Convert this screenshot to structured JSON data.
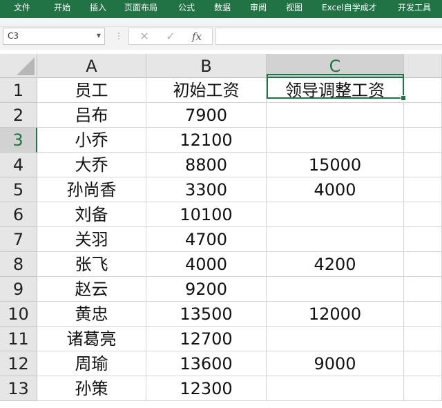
{
  "ribbon": {
    "tabs": [
      "文件",
      "开始",
      "插入",
      "页面布局",
      "公式",
      "数据",
      "审阅",
      "视图",
      "Excel自学成才",
      "开发工具"
    ]
  },
  "formula_bar": {
    "name_box": "C3",
    "cancel_icon": "✕",
    "enter_icon": "✓",
    "function_label": "fx",
    "formula": ""
  },
  "sheet": {
    "selected_cell": "C3",
    "columns": [
      "A",
      "B",
      "C"
    ],
    "rows": [
      {
        "num": "1",
        "cells": [
          "员工",
          "初始工资",
          "领导调整工资"
        ]
      },
      {
        "num": "2",
        "cells": [
          "吕布",
          "7900",
          ""
        ]
      },
      {
        "num": "3",
        "cells": [
          "小乔",
          "12100",
          ""
        ]
      },
      {
        "num": "4",
        "cells": [
          "大乔",
          "8800",
          "15000"
        ]
      },
      {
        "num": "5",
        "cells": [
          "孙尚香",
          "3300",
          "4000"
        ]
      },
      {
        "num": "6",
        "cells": [
          "刘备",
          "10100",
          ""
        ]
      },
      {
        "num": "7",
        "cells": [
          "关羽",
          "4700",
          ""
        ]
      },
      {
        "num": "8",
        "cells": [
          "张飞",
          "4000",
          "4200"
        ]
      },
      {
        "num": "9",
        "cells": [
          "赵云",
          "9200",
          ""
        ]
      },
      {
        "num": "10",
        "cells": [
          "黄忠",
          "13500",
          "12000"
        ]
      },
      {
        "num": "11",
        "cells": [
          "诸葛亮",
          "12700",
          ""
        ]
      },
      {
        "num": "12",
        "cells": [
          "周瑜",
          "13600",
          "9000"
        ]
      },
      {
        "num": "13",
        "cells": [
          "孙策",
          "12300",
          ""
        ]
      }
    ]
  },
  "colors": {
    "accent": "#217346",
    "header_bg": "#e6e6e6",
    "selected_header_bg": "#d2d2d2"
  }
}
